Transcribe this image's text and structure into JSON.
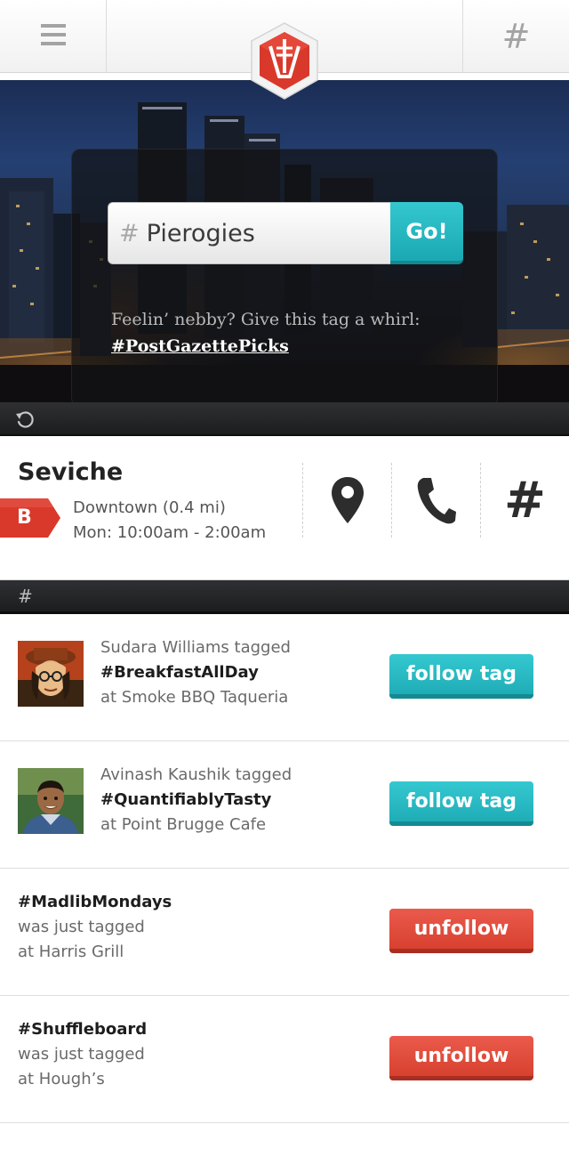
{
  "header": {
    "menu_icon": "hamburger-menu-icon",
    "logo_icon": "app-logo-icon",
    "hashtag_label": "#",
    "colors": {
      "logo_red": "#d9392b",
      "bar_bg": "#f5f5f5"
    }
  },
  "hero": {
    "search": {
      "hash_prefix": "#",
      "value": "Pierogies",
      "go_label": "Go!"
    },
    "suggestion": {
      "text": "Feelin’ nebby? Give this tag a whirl:",
      "tag": "#PostGazettePicks"
    }
  },
  "refresh_icon": "refresh-icon",
  "venue": {
    "name": "Seviche",
    "grade": "B",
    "location": "Downtown (0.4 mi)",
    "hours": "Mon: 10:00am - 2:00am",
    "actions": {
      "map_icon": "map-pin-icon",
      "phone_icon": "phone-icon",
      "hashtag": "#"
    }
  },
  "hash_section_label": "#",
  "feed": [
    {
      "user": "Sudara Williams tagged",
      "tag": "#BreakfastAllDay",
      "place": "at Smoke BBQ Taqueria",
      "button": "follow tag"
    },
    {
      "user": "Avinash Kaushik tagged",
      "tag": "#QuantifiablyTasty",
      "place": "at Point Brugge Cafe",
      "button": "follow tag"
    },
    {
      "tag": "#MadlibMondays",
      "line2": "was just tagged",
      "place": "at Harris Grill",
      "button": "unfollow"
    },
    {
      "tag": "#Shuffleboard",
      "line2": "was just tagged",
      "place": "at Hough’s",
      "button": "unfollow"
    }
  ],
  "colors": {
    "follow": "#22b2bb",
    "unfollow": "#de4a3a",
    "dark_bar": "#26282b"
  }
}
